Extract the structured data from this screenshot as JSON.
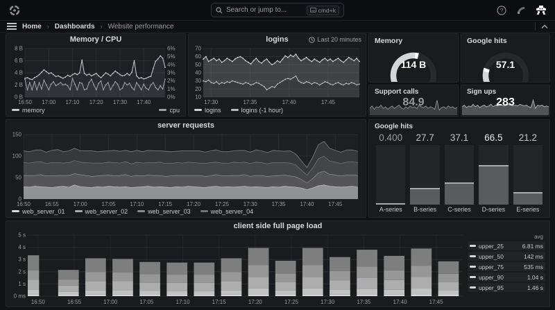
{
  "nav": {
    "search_placeholder": "Search or jump to...",
    "search_shortcut": "cmd+k"
  },
  "breadcrumb": {
    "items": [
      "Home",
      "Dashboards",
      "Website performance"
    ]
  },
  "colors": {
    "page_bg": "#111215",
    "panel_bg": "#191b1f",
    "panel_border": "#25272b",
    "title_text": "#d8d9da",
    "axis_text": "#9a9ca0",
    "grid": "rgba(255,255,255,0.07)"
  },
  "chart_data": [
    {
      "id": "memory_cpu",
      "type": "line",
      "title": "Memory / CPU",
      "x_ticks": [
        "16:50",
        "17:00",
        "17:10",
        "17:20",
        "17:30",
        "17:40"
      ],
      "ylim": [
        0,
        8
      ],
      "y_ticks": [
        "0 B",
        "2 B",
        "4 B",
        "6 B",
        "8 B"
      ],
      "y2lim": [
        0,
        6
      ],
      "y2_ticks": [
        "0%",
        "1%",
        "2%",
        "3%",
        "4%",
        "5%",
        "6%"
      ],
      "series": [
        {
          "name": "memory",
          "axis": "left",
          "color": "#c9cbce",
          "fill": "rgba(200,202,206,0.07)",
          "values": [
            3.1,
            3.2,
            3.0,
            2.9,
            3.2,
            3.4,
            3.7,
            4.1,
            4.5,
            4.2,
            3.9,
            4.0,
            3.7,
            3.4,
            3.5,
            3.3,
            3.1,
            3.3,
            3.6,
            3.4,
            3.7,
            3.9,
            3.7,
            4.0,
            6.1,
            3.9,
            3.6,
            3.8,
            3.5,
            3.7,
            3.9,
            3.5,
            3.2,
            3.6,
            4.0,
            3.8,
            3.5,
            3.9,
            4.3,
            4.0,
            3.7,
            3.5,
            3.6,
            3.9,
            3.6,
            4.1,
            6.0,
            3.5,
            3.1,
            3.2,
            3.0,
            3.1,
            3.3,
            3.4,
            4.7,
            5.9,
            6.3,
            6.8,
            6.4,
            4.9
          ]
        },
        {
          "name": "cpu",
          "axis": "right",
          "color": "#9fa2a6",
          "fill": "rgba(160,163,167,0.08)",
          "values": [
            2.2,
            0.9,
            1.8,
            0.9,
            1.9,
            0.9,
            1.8,
            1.0,
            2.1,
            1.5,
            0.9,
            1.6,
            1.9,
            1.4,
            1.6,
            1.8,
            1.5,
            1.6,
            1.4,
            0.9,
            2.3,
            1.6,
            0.9,
            1.8,
            1.7,
            0.9,
            1.0,
            1.8,
            2.2,
            1.5,
            0.9,
            1.7,
            2.0,
            0.9,
            1.5,
            1.8,
            0.9,
            1.4,
            1.9,
            1.6,
            0.9,
            1.1,
            1.8,
            1.5,
            1.7,
            1.2,
            0.9,
            1.8,
            1.4,
            0.9,
            1.6,
            1.1,
            0.9,
            1.5,
            1.8,
            1.2,
            0.9,
            1.4,
            1.0,
            2.2
          ]
        }
      ]
    },
    {
      "id": "logins",
      "type": "line",
      "title": "logins",
      "time_range": "Last 20 minutes",
      "x_ticks": [
        "17:30",
        "17:35",
        "17:40",
        "17:45"
      ],
      "ylim": [
        10,
        70
      ],
      "y_ticks": [
        "10",
        "20",
        "30",
        "40",
        "50",
        "60",
        "70"
      ],
      "series": [
        {
          "name": "logins",
          "axis": "left",
          "color": "#d2d4d7",
          "fill": "rgba(190,192,196,0.22)",
          "values": [
            57,
            60,
            54,
            56,
            58,
            55,
            57,
            53,
            55,
            58,
            56,
            54,
            57,
            59,
            60,
            58,
            55,
            53,
            51,
            55,
            58,
            54,
            52,
            55,
            57,
            53,
            50,
            52,
            55,
            53,
            57,
            61,
            59,
            62,
            60,
            63,
            58,
            55,
            57,
            59,
            56,
            54,
            57,
            55,
            53,
            56,
            58,
            55,
            57,
            54,
            56,
            58,
            55,
            53,
            56,
            59,
            57,
            55,
            58,
            54
          ]
        },
        {
          "name": "logins (-1 hour)",
          "axis": "left",
          "color": "#b9bbbe",
          "fill": "rgba(0,0,0,0.12)",
          "values": [
            30,
            29,
            31,
            28,
            27,
            29,
            26,
            28,
            27,
            29,
            28,
            30,
            29,
            28,
            27,
            26,
            28,
            27,
            25,
            26,
            28,
            27,
            25,
            23,
            19,
            21,
            23,
            22,
            26,
            28,
            30,
            32,
            33,
            32,
            34,
            36,
            30,
            28,
            27,
            29,
            28,
            26,
            28,
            27,
            25,
            27,
            29,
            28,
            26,
            25,
            27,
            28,
            26,
            25,
            27,
            26,
            28,
            27,
            25,
            26
          ]
        }
      ]
    },
    {
      "id": "server_requests",
      "type": "area",
      "title": "server requests",
      "stacked": true,
      "x_ticks": [
        "16:50",
        "16:55",
        "17:00",
        "17:05",
        "17:10",
        "17:15",
        "17:20",
        "17:25",
        "17:30",
        "17:35",
        "17:40",
        "17:45"
      ],
      "ylim": [
        0,
        150
      ],
      "y_ticks": [
        "0",
        "50",
        "100",
        "150"
      ],
      "series": [
        {
          "name": "web_server_01",
          "color": "#d8dadd",
          "fill": "#97999c",
          "values": [
            29,
            28,
            30,
            29,
            28,
            27,
            29,
            30,
            28,
            33,
            29,
            28,
            27,
            29,
            28,
            30,
            29,
            28,
            29,
            27,
            28,
            29,
            30,
            28,
            29,
            28,
            27,
            29,
            28,
            30,
            29,
            28,
            27,
            29,
            30,
            28,
            29,
            28,
            29,
            30,
            28,
            29,
            28,
            27,
            29,
            28,
            30,
            29,
            28,
            26,
            22,
            26,
            31,
            33,
            30,
            29,
            28,
            29,
            30,
            28
          ]
        },
        {
          "name": "web_server_02",
          "color": "#a9abae",
          "fill": "#58595c",
          "values": [
            26,
            27,
            25,
            28,
            26,
            27,
            26,
            25,
            27,
            26,
            28,
            27,
            26,
            25,
            27,
            26,
            25,
            27,
            28,
            26,
            27,
            25,
            26,
            27,
            26,
            25,
            27,
            26,
            27,
            25,
            26,
            27,
            26,
            25,
            27,
            26,
            25,
            27,
            26,
            27,
            25,
            26,
            27,
            26,
            25,
            27,
            26,
            25,
            24,
            20,
            16,
            22,
            30,
            32,
            28,
            27,
            26,
            27,
            26,
            27
          ]
        },
        {
          "name": "web_server_03",
          "color": "#8a8c8f",
          "fill": "#47484b",
          "values": [
            30,
            29,
            31,
            30,
            29,
            31,
            30,
            29,
            30,
            31,
            29,
            30,
            31,
            30,
            29,
            30,
            31,
            29,
            30,
            29,
            31,
            30,
            29,
            30,
            31,
            30,
            29,
            30,
            29,
            31,
            30,
            29,
            30,
            31,
            29,
            30,
            29,
            31,
            30,
            29,
            30,
            31,
            30,
            29,
            31,
            30,
            29,
            30,
            28,
            22,
            18,
            25,
            33,
            35,
            31,
            30,
            29,
            30,
            31,
            30
          ]
        },
        {
          "name": "web_server_04",
          "color": "#707275",
          "fill": "#393a3d",
          "values": [
            27,
            26,
            28,
            27,
            26,
            28,
            30,
            26,
            27,
            28,
            26,
            27,
            28,
            26,
            27,
            26,
            28,
            27,
            26,
            28,
            27,
            26,
            28,
            27,
            26,
            28,
            27,
            26,
            28,
            26,
            27,
            28,
            26,
            27,
            28,
            26,
            27,
            26,
            28,
            27,
            26,
            28,
            27,
            26,
            28,
            27,
            26,
            28,
            25,
            21,
            17,
            24,
            32,
            34,
            29,
            27,
            26,
            28,
            27,
            26
          ]
        }
      ]
    },
    {
      "id": "google_hits_bars",
      "type": "bar",
      "title": "Google hits",
      "max": 100,
      "categories": [
        "A-series",
        "B-series",
        "C-series",
        "D-series",
        "E-series"
      ],
      "values": [
        0.4,
        27.7,
        37.1,
        66.5,
        21.2
      ],
      "display": [
        "0.400",
        "27.7",
        "37.1",
        "66.5",
        "21.2"
      ],
      "value_colors": [
        "#9a9b9d",
        "#c3c4c6",
        "#c3c4c6",
        "#e9eaeb",
        "#c3c4c6"
      ]
    },
    {
      "id": "page_load",
      "type": "bar",
      "title": "client side full page load",
      "stacked": true,
      "ylim": [
        0,
        5
      ],
      "y_ticks": [
        "0 ms",
        "1 s",
        "2 s",
        "3 s",
        "4 s",
        "5 s"
      ],
      "x_ticks": [
        "16:50",
        "16:55",
        "17:00",
        "17:05",
        "17:10",
        "17:15",
        "17:20",
        "17:25",
        "17:30",
        "17:35",
        "17:40",
        "17:45"
      ],
      "totals": [
        3.35,
        2.15,
        3.1,
        3.05,
        2.8,
        2.75,
        2.75,
        3.1,
        3.95,
        2.9,
        3.95,
        3.2,
        3.8,
        3.3,
        3.9,
        2.85
      ],
      "cum_fracs": [
        0.04,
        0.16,
        0.4,
        0.64,
        1.0
      ],
      "segment_colors": [
        "#d9d9d9",
        "#c2c2c2",
        "#adadad",
        "#979797",
        "#7e7e7e"
      ],
      "legend_header": "avg",
      "legend": [
        {
          "name": "upper_25",
          "avg": "6.81 ms"
        },
        {
          "name": "upper_50",
          "avg": "142 ms"
        },
        {
          "name": "upper_75",
          "avg": "535 ms"
        },
        {
          "name": "upper_90",
          "avg": "1.04 s"
        },
        {
          "name": "upper_95",
          "avg": "1.46 s"
        }
      ]
    },
    {
      "id": "memory_gauge",
      "type": "gauge",
      "title": "Memory",
      "value": "114 B",
      "fill_fraction": 0.55,
      "track_color": "#26282c",
      "fill_color": "#d4d5d7",
      "cap_color": "#ffffff"
    },
    {
      "id": "google_hits_gauge",
      "type": "gauge",
      "title": "Google hits",
      "value": "57.1",
      "fill_fraction": 0.24,
      "track_color": "#26282c",
      "fill_color": "#d4d5d7",
      "cap_color": "#ffffff"
    },
    {
      "id": "support_calls",
      "type": "stat",
      "title": "Support calls",
      "value": "84.9",
      "value_color": "#98999b",
      "spark_fill": "#3c3e41",
      "spark_stroke": "#85878a",
      "spark": [
        0.4,
        0.55,
        0.35,
        0.5,
        0.45,
        0.6,
        0.4,
        0.5,
        0.35,
        0.45,
        0.55,
        0.4,
        0.5,
        0.6,
        0.45,
        0.35,
        0.5,
        0.4,
        0.55,
        0.45,
        0.5,
        0.4,
        0.6,
        0.5,
        0.45,
        0.55,
        0.4,
        0.5,
        0.45,
        0.35,
        0.9,
        0.3,
        0.45,
        0.5,
        0.4,
        0.55,
        0.45,
        0.5,
        0.4,
        0.45
      ]
    },
    {
      "id": "sign_ups",
      "type": "stat",
      "title": "Sign ups",
      "value": "283",
      "value_color": "#ffffff",
      "spark_fill": "#515356",
      "spark_stroke": "#a7a9ac",
      "spark": [
        0.5,
        0.6,
        0.45,
        0.55,
        0.5,
        0.65,
        0.5,
        0.6,
        0.45,
        0.55,
        0.6,
        0.5,
        0.55,
        0.65,
        0.5,
        0.6,
        0.55,
        0.65,
        0.6,
        0.55,
        0.6,
        0.65,
        0.6,
        0.55,
        0.6,
        0.55,
        0.65,
        0.6,
        0.55,
        0.6,
        0.5,
        0.45,
        0.9,
        0.4,
        0.6,
        0.55,
        0.6,
        0.5,
        0.55,
        0.5
      ]
    }
  ]
}
